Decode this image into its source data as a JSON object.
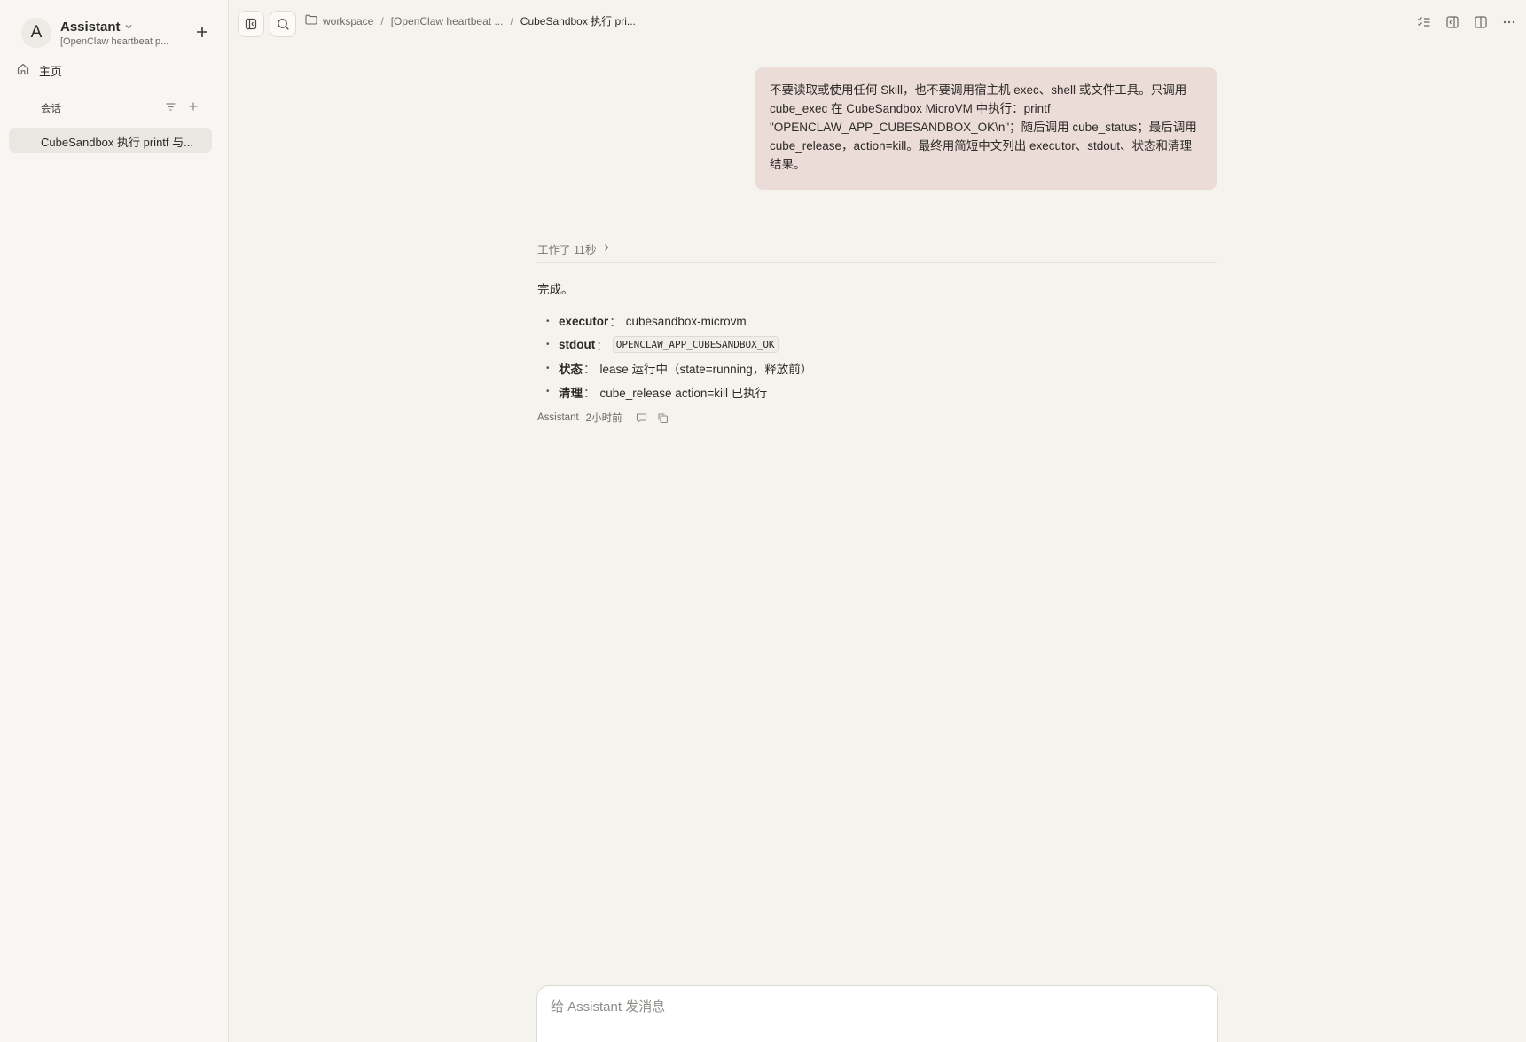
{
  "sidebar": {
    "avatar_letter": "A",
    "assistant_name": "Assistant",
    "workspace_sub": "[OpenClaw heartbeat p...",
    "home_label": "主页",
    "section_label": "会话",
    "conversation_title": "CubeSandbox 执行 printf 与..."
  },
  "topbar": {
    "breadcrumbs": [
      "workspace",
      "[OpenClaw heartbeat ...",
      "CubeSandbox 执行 pri..."
    ],
    "separator": "/"
  },
  "chat": {
    "user_message": "不要读取或使用任何 Skill，也不要调用宿主机 exec、shell 或文件工具。只调用 cube_exec 在 CubeSandbox MicroVM 中执行：printf \"OPENCLAW_APP_CUBESANDBOX_OK\\n\"；随后调用 cube_status；最后调用 cube_release，action=kill。最终用简短中文列出 executor、stdout、状态和清理结果。",
    "worked_label": "工作了 11秒",
    "done_text": "完成。",
    "bullets": [
      {
        "key": "executor",
        "sep": "：",
        "value": "cubesandbox-microvm"
      },
      {
        "key": "stdout",
        "sep": "：",
        "value": "OPENCLAW_APP_CUBESANDBOX_OK"
      },
      {
        "key": "状态",
        "sep": "：",
        "value": "lease 运行中（state=running，释放前）"
      },
      {
        "key": "清理",
        "sep": "：",
        "value": "cube_release action=kill 已执行"
      }
    ],
    "meta_author": "Assistant",
    "meta_time": "2小时前"
  },
  "composer": {
    "placeholder": "给 Assistant 发消息"
  },
  "colors": {
    "user_bubble": "#ecdcd8",
    "sidebar_bg": "#f7f6f3",
    "main_bg": "#f4f3ee"
  }
}
